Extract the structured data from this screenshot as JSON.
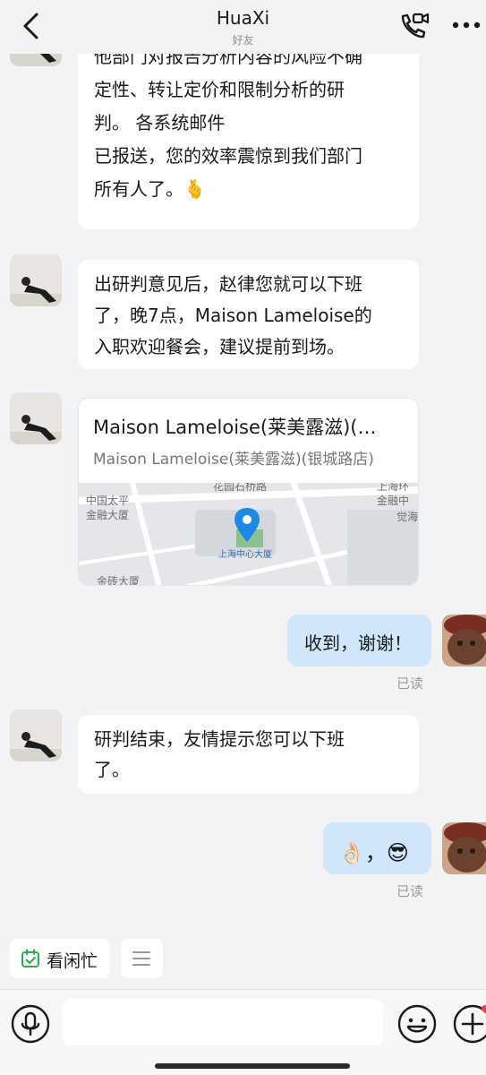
{
  "header": {
    "title": "HuaXi",
    "subtitle": "好友",
    "icons": [
      "back-arrow-icon",
      "video-call-icon",
      "more-icon"
    ]
  },
  "messages": [
    {
      "sender": "contact",
      "lines": [
        "他部门对报告分析内容的风险不确",
        "定性、转让定价和限制分析的研",
        "判。                       各系统邮件",
        "已报送，您的效率震惊到我们部门",
        "所有人了。🫰"
      ]
    },
    {
      "sender": "contact",
      "lines": [
        "出研判意见后，赵律您就可以下班",
        "了，晚7点，Maison Lameloise的",
        "入职欢迎餐会，建议提前到场。"
      ]
    },
    {
      "sender": "contact",
      "type": "location",
      "title": "Maison Lameloise(莱美露滋)(…",
      "address": "Maison Lameloise(莱美露滋)(银城路店)",
      "map_labels": [
        "花园石桥路",
        "中国太平",
        "金融大厦",
        "上海中心大厦",
        "上海环",
        "金融中",
        "觉海",
        "金砖大厦"
      ]
    },
    {
      "sender": "me",
      "text": "收到，谢谢！",
      "status": "已读"
    },
    {
      "sender": "contact",
      "lines": [
        "研判结束，友情提示您可以下班",
        "了。"
      ]
    },
    {
      "sender": "me",
      "text": "👌🏻，😎",
      "status": "已读"
    }
  ],
  "quick_actions": {
    "busy_label": "看闲忙",
    "busy_icon": "calendar-check-icon",
    "menu_icon": "menu-lines-icon"
  },
  "input_bar": {
    "placeholder": "",
    "icons": [
      "microphone-icon",
      "thumbs-up-icon",
      "emoji-icon",
      "plus-icon"
    ]
  },
  "colors": {
    "background": "#f2f3f5",
    "bubble_me": "#cfe6fb",
    "bubble_contact": "#ffffff",
    "accent_blue": "#1e88e5",
    "busy_green": "#22b14c",
    "notification_red": "#f04040"
  }
}
